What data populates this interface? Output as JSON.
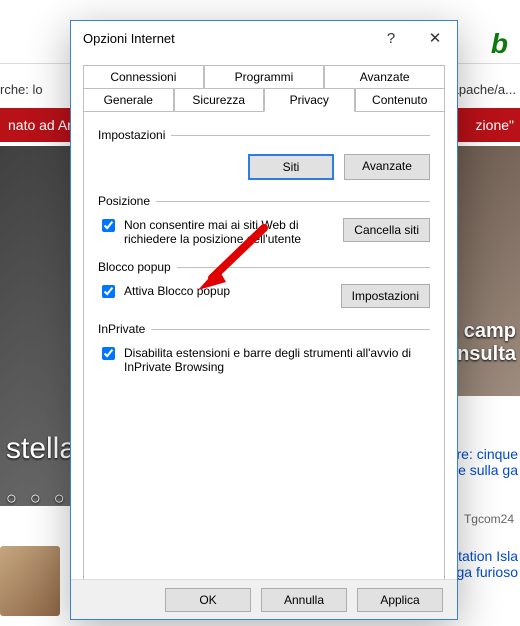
{
  "background": {
    "bing_glyph": "b",
    "search_label": "rche:   lo",
    "url_fragment": "/apache/a...",
    "red_left": "nato ad Ar",
    "red_right": "zione\"",
    "hero_right_line1": "in camp",
    "hero_right_line2": "i insulta",
    "hero_left": "stella",
    "dots": "○ ○ ○ ○ ○ ○ ○ ○ ○",
    "side1_line1": "nore: cinque",
    "side1_line2": "pere sulla ga",
    "side2": "Tgcom24",
    "side3_line1": "ptation Isla",
    "side3_line2": "nga furioso"
  },
  "dialog": {
    "title": "Opzioni Internet",
    "help": "?",
    "close": "✕",
    "tabs_upper": [
      "Connessioni",
      "Programmi",
      "Avanzate"
    ],
    "tabs_lower": [
      "Generale",
      "Sicurezza",
      "Privacy",
      "Contenuto"
    ],
    "active_tab": "Privacy",
    "sections": {
      "impostazioni": {
        "legend": "Impostazioni",
        "siti": "Siti",
        "avanzate": "Avanzate"
      },
      "posizione": {
        "legend": "Posizione",
        "checkbox": "Non consentire mai ai siti Web di richiedere la posizione dell'utente",
        "cancella": "Cancella siti"
      },
      "blocco": {
        "legend": "Blocco popup",
        "checkbox": "Attiva Blocco popup",
        "impostazioni": "Impostazioni"
      },
      "inprivate": {
        "legend": "InPrivate",
        "checkbox": "Disabilita estensioni e barre degli strumenti all'avvio di InPrivate Browsing"
      }
    },
    "buttons": {
      "ok": "OK",
      "annulla": "Annulla",
      "applica": "Applica"
    }
  }
}
